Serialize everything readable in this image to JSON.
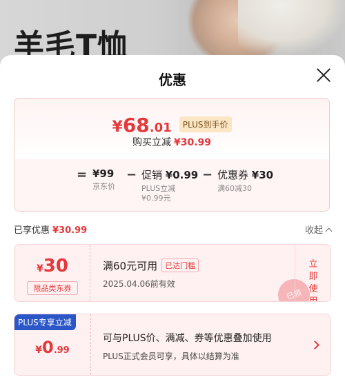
{
  "background": {
    "product_title": "羊毛T恤"
  },
  "sheet": {
    "title": "优惠"
  },
  "price_card": {
    "symbol": "¥",
    "price_int": "68",
    "price_dec": ".01",
    "plus_tag": "PLUS到手价",
    "saving_label": "购买立减",
    "saving_amount": "¥30.99",
    "breakdown": {
      "eq": "=",
      "minus1": "−",
      "minus2": "−",
      "jd_price": "¥99",
      "jd_price_label": "京东价",
      "promo_label": "促销",
      "promo_value": "¥0.99",
      "promo_sub1": "PLUS立减",
      "promo_sub2": "¥0.99元",
      "coupon_label": "优惠券",
      "coupon_value": "¥30",
      "coupon_sub": "满60减30"
    }
  },
  "enjoyed": {
    "label": "已享优惠",
    "amount": "¥30.99",
    "collapse_label": "收起"
  },
  "coupon": {
    "symbol": "¥",
    "value": "30",
    "scope": "限品类东券",
    "condition": "满60元可用",
    "met_tag": "已达门槛",
    "expiry": "2025.04.06前有效",
    "use_now_1": "立即",
    "use_now_2": "使用",
    "stamp": "已领"
  },
  "plus": {
    "badge": "PLUS专享立减",
    "symbol": "¥",
    "int": "0",
    "dec": ".99",
    "line1": "可与PLUS价、满减、券等优惠叠加使用",
    "line2": "PLUS正式会员可享，具体以结算为准"
  },
  "colors": {
    "accent": "#e4393c",
    "plus_blue": "#2b56c7",
    "plus_gold": "#fbe7c6"
  }
}
